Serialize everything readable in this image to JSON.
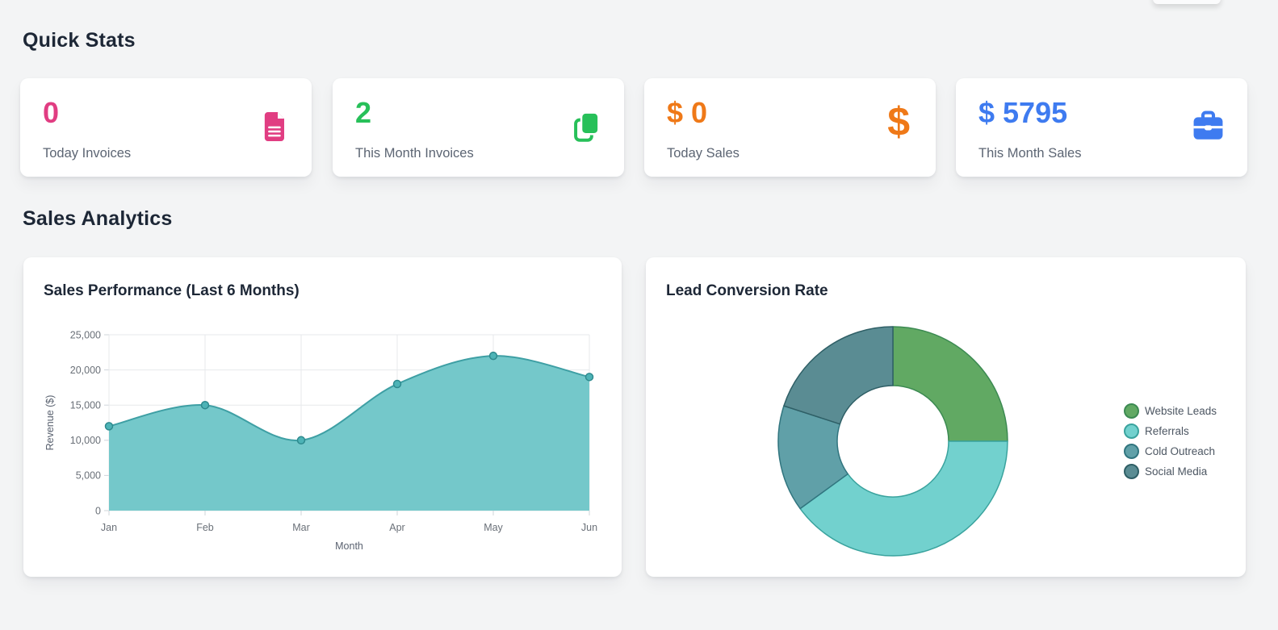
{
  "sections": {
    "quick_stats": "Quick Stats",
    "sales_analytics": "Sales Analytics"
  },
  "stats": [
    {
      "value": "0",
      "label": "Today Invoices",
      "color": "#e13d82",
      "icon": "invoice-file-icon"
    },
    {
      "value": "2",
      "label": "This Month Invoices",
      "color": "#27c059",
      "icon": "copy-documents-icon"
    },
    {
      "value": "$ 0",
      "label": "Today Sales",
      "color": "#ef7918",
      "icon": "dollar-icon"
    },
    {
      "value": "$ 5795",
      "label": "This Month Sales",
      "color": "#3e7bf0",
      "icon": "briefcase-icon"
    }
  ],
  "chart_data": [
    {
      "type": "area",
      "title": "Sales Performance (Last 6 Months)",
      "x": [
        "Jan",
        "Feb",
        "Mar",
        "Apr",
        "May",
        "Jun"
      ],
      "values": [
        12000,
        15000,
        10000,
        18000,
        22000,
        19000
      ],
      "xlabel": "Month",
      "ylabel": "Revenue ($)",
      "ylim": [
        0,
        25000
      ],
      "ytick_step": 5000,
      "ytick_labels": [
        "0",
        "5,000",
        "10,000",
        "15,000",
        "20,000",
        "25,000"
      ],
      "grid": true,
      "colors": {
        "fill": "#6fc6c8",
        "line": "#3e9fa4",
        "point_fill": "#4db3b6",
        "point_stroke": "#2e8a8e",
        "gridline": "#e7e9eb",
        "tick": "#cfd4da",
        "tick_text": "#6a7078",
        "axis_label": "#5a6270"
      }
    },
    {
      "type": "donut",
      "title": "Lead Conversion Rate",
      "labels": [
        "Website Leads",
        "Referrals",
        "Cold Outreach",
        "Social Media"
      ],
      "values": [
        25,
        40,
        15,
        20
      ],
      "colors": [
        "#61a963",
        "#72d1ce",
        "#60a0a8",
        "#5a8c93"
      ],
      "stroke_colors": [
        "#3c8a52",
        "#3aa39e",
        "#31757f",
        "#2f5f66"
      ],
      "legend_position": "right"
    }
  ]
}
